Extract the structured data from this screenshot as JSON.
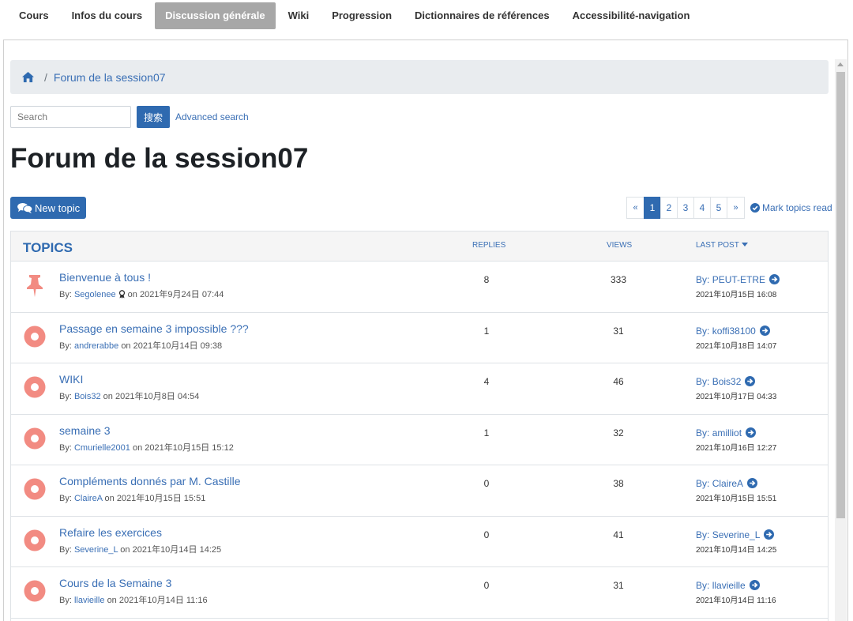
{
  "nav": {
    "tabs": [
      {
        "label": "Cours",
        "active": false
      },
      {
        "label": "Infos du cours",
        "active": false
      },
      {
        "label": "Discussion générale",
        "active": true
      },
      {
        "label": "Wiki",
        "active": false
      },
      {
        "label": "Progression",
        "active": false
      },
      {
        "label": "Dictionnaires de références",
        "active": false
      },
      {
        "label": "Accessibilité-navigation",
        "active": false
      }
    ]
  },
  "breadcrumb": {
    "home_icon": "home-icon",
    "separator": "/",
    "current": "Forum de la session07"
  },
  "search": {
    "placeholder": "Search",
    "button_label": "搜索",
    "advanced_label": "Advanced search"
  },
  "page": {
    "title": "Forum de la session07",
    "new_topic_label": "New topic",
    "mark_read_label": "Mark topics read"
  },
  "pagination": {
    "prev": "«",
    "next": "»",
    "pages": [
      "1",
      "2",
      "3",
      "4",
      "5"
    ],
    "current": "1"
  },
  "table": {
    "headers": {
      "topics": "TOPICS",
      "replies": "REPLIES",
      "views": "VIEWS",
      "last_post": "LAST POST"
    },
    "by_prefix": "By:",
    "on_word": "on",
    "rows": [
      {
        "icon": "pin-icon",
        "title": "Bienvenue à tous !",
        "author": "Segolenee",
        "badge": true,
        "date": "2021年9月24日 07:44",
        "replies": "8",
        "views": "333",
        "last_by": "PEUT-ETRE",
        "last_date": "2021年10月15日 16:08"
      },
      {
        "icon": "topic-icon",
        "title": "Passage en semaine 3 impossible ???",
        "author": "andrerabbe",
        "badge": false,
        "date": "2021年10月14日 09:38",
        "replies": "1",
        "views": "31",
        "last_by": "koffi38100",
        "last_date": "2021年10月18日 14:07"
      },
      {
        "icon": "topic-icon",
        "title": "WIKI",
        "author": "Bois32",
        "badge": false,
        "date": "2021年10月8日 04:54",
        "replies": "4",
        "views": "46",
        "last_by": "Bois32",
        "last_date": "2021年10月17日 04:33"
      },
      {
        "icon": "topic-icon",
        "title": "semaine 3",
        "author": "Cmurielle2001",
        "badge": false,
        "date": "2021年10月15日 15:12",
        "replies": "1",
        "views": "32",
        "last_by": "amilliot",
        "last_date": "2021年10月16日 12:27"
      },
      {
        "icon": "topic-icon",
        "title": "Compléments donnés par M. Castille",
        "author": "ClaireA",
        "badge": false,
        "date": "2021年10月15日 15:51",
        "replies": "0",
        "views": "38",
        "last_by": "ClaireA",
        "last_date": "2021年10月15日 15:51"
      },
      {
        "icon": "topic-icon",
        "title": "Refaire les exercices",
        "author": "Severine_L",
        "badge": false,
        "date": "2021年10月14日 14:25",
        "replies": "0",
        "views": "41",
        "last_by": "Severine_L",
        "last_date": "2021年10月14日 14:25"
      },
      {
        "icon": "topic-icon",
        "title": "Cours de la Semaine 3",
        "author": "llavieille",
        "badge": false,
        "date": "2021年10月14日 11:16",
        "replies": "0",
        "views": "31",
        "last_by": "llavieille",
        "last_date": "2021年10月14日 11:16"
      }
    ]
  },
  "colors": {
    "accent": "#2f6ab0",
    "link": "#3a6fb5",
    "topic_icon": "#f28b82",
    "active_tab": "#a7a7a7"
  }
}
